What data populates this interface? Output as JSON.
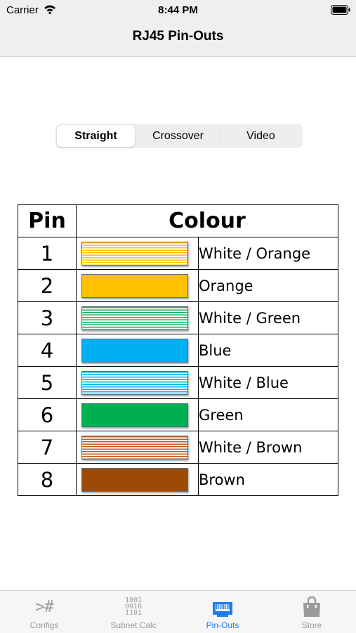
{
  "status": {
    "carrier": "Carrier",
    "time": "8:44 PM"
  },
  "nav": {
    "title": "RJ45 Pin-Outs"
  },
  "segments": [
    {
      "label": "Straight",
      "selected": true
    },
    {
      "label": "Crossover",
      "selected": false
    },
    {
      "label": "Video",
      "selected": false
    }
  ],
  "table": {
    "headers": {
      "pin": "Pin",
      "colour": "Colour"
    },
    "rows": [
      {
        "pin": "1",
        "colour": "White / Orange",
        "base": "#ffc000",
        "striped": true
      },
      {
        "pin": "2",
        "colour": "Orange",
        "base": "#ffc000",
        "striped": false
      },
      {
        "pin": "3",
        "colour": "White / Green",
        "base": "#00b050",
        "striped": true
      },
      {
        "pin": "4",
        "colour": "Blue",
        "base": "#00b0f0",
        "striped": false
      },
      {
        "pin": "5",
        "colour": "White / Blue",
        "base": "#00b0f0",
        "striped": true
      },
      {
        "pin": "6",
        "colour": "Green",
        "base": "#00b050",
        "striped": false
      },
      {
        "pin": "7",
        "colour": "White / Brown",
        "base": "#c55a11",
        "striped": true
      },
      {
        "pin": "8",
        "colour": "Brown",
        "base": "#9c4a06",
        "striped": false
      }
    ]
  },
  "tabs": [
    {
      "label": "Configs",
      "icon": "terminal-icon",
      "glyph": ">#",
      "active": false
    },
    {
      "label": "Subnet Calc",
      "icon": "binary-icon",
      "glyph": "1001\n0010\n1101",
      "active": false
    },
    {
      "label": "Pin-Outs",
      "icon": "ethernet-port-icon",
      "active": true
    },
    {
      "label": "Store",
      "icon": "shopping-bag-icon",
      "active": false
    }
  ],
  "colors": {
    "accent": "#1e7cf2",
    "tab_inactive": "#999999"
  }
}
